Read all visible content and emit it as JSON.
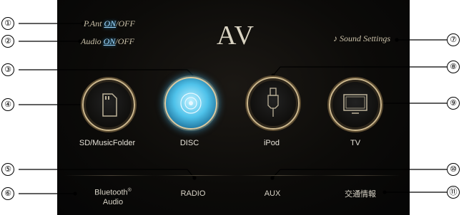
{
  "callouts": [
    "①",
    "②",
    "③",
    "④",
    "⑤",
    "⑥",
    "⑦",
    "⑧",
    "⑨",
    "⑩",
    "⑪"
  ],
  "title": "AV",
  "toggles": {
    "pant": {
      "label": "P.Ant ",
      "on": "ON",
      "sep": "/",
      "off": "OFF"
    },
    "audio": {
      "label": "Audio ",
      "on": "ON",
      "sep": "/",
      "off": "OFF"
    }
  },
  "sound_settings": "♪ Sound Settings",
  "sources": [
    {
      "key": "sd",
      "label": "SD/MusicFolder",
      "icon": "sd-card-icon"
    },
    {
      "key": "disc",
      "label": "DISC",
      "icon": "disc-icon"
    },
    {
      "key": "ipod",
      "label": "iPod",
      "icon": "usb-plug-icon"
    },
    {
      "key": "tv",
      "label": "TV",
      "icon": "tv-icon"
    }
  ],
  "bottom": {
    "bluetooth": {
      "line1": "Bluetooth",
      "mark": "®",
      "line2": "Audio"
    },
    "radio": "RADIO",
    "aux": "AUX",
    "traffic": "交通情報"
  },
  "colors": {
    "gold_ring": "#cbb68c",
    "active_blue": "#4fc2ea",
    "on_blue": "#9fd8ff"
  }
}
